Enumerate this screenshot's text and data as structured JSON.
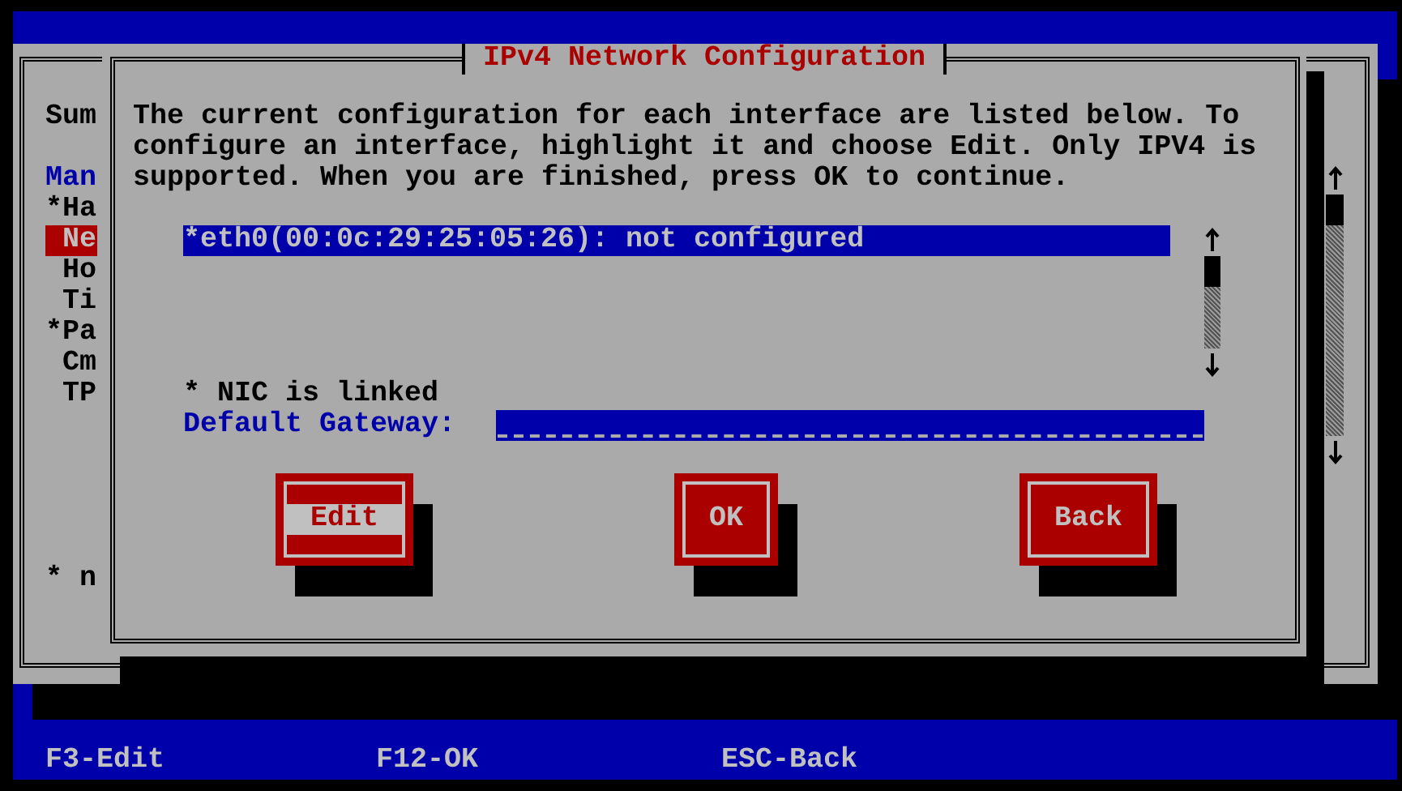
{
  "background_window": {
    "heading": "Sum",
    "section": "Man",
    "items": [
      {
        "label": "*Ha",
        "selected": false
      },
      {
        "label": " Ne",
        "selected": true
      },
      {
        "label": " Ho",
        "selected": false
      },
      {
        "label": " Ti",
        "selected": false
      },
      {
        "label": "*Pa",
        "selected": false
      },
      {
        "label": " Cm",
        "selected": false
      },
      {
        "label": " TP",
        "selected": false
      }
    ],
    "footnote": "* n"
  },
  "dialog": {
    "title": "IPv4 Network Configuration",
    "message": "The current configuration for each interface are listed below. To configure an interface, highlight it and choose Edit. Only IPV4 is supported. When you are finished, press OK to continue.",
    "interfaces": [
      {
        "label": "*eth0(00:0c:29:25:05:26): not configured",
        "selected": true
      }
    ],
    "legend": "* NIC is linked",
    "gateway": {
      "label": "Default Gateway:"
    },
    "buttons": [
      {
        "label": "Edit",
        "focused": true
      },
      {
        "label": "OK",
        "focused": false
      },
      {
        "label": "Back",
        "focused": false
      }
    ]
  },
  "status_bar": [
    "F3-Edit",
    "F12-OK",
    "ESC-Back"
  ]
}
